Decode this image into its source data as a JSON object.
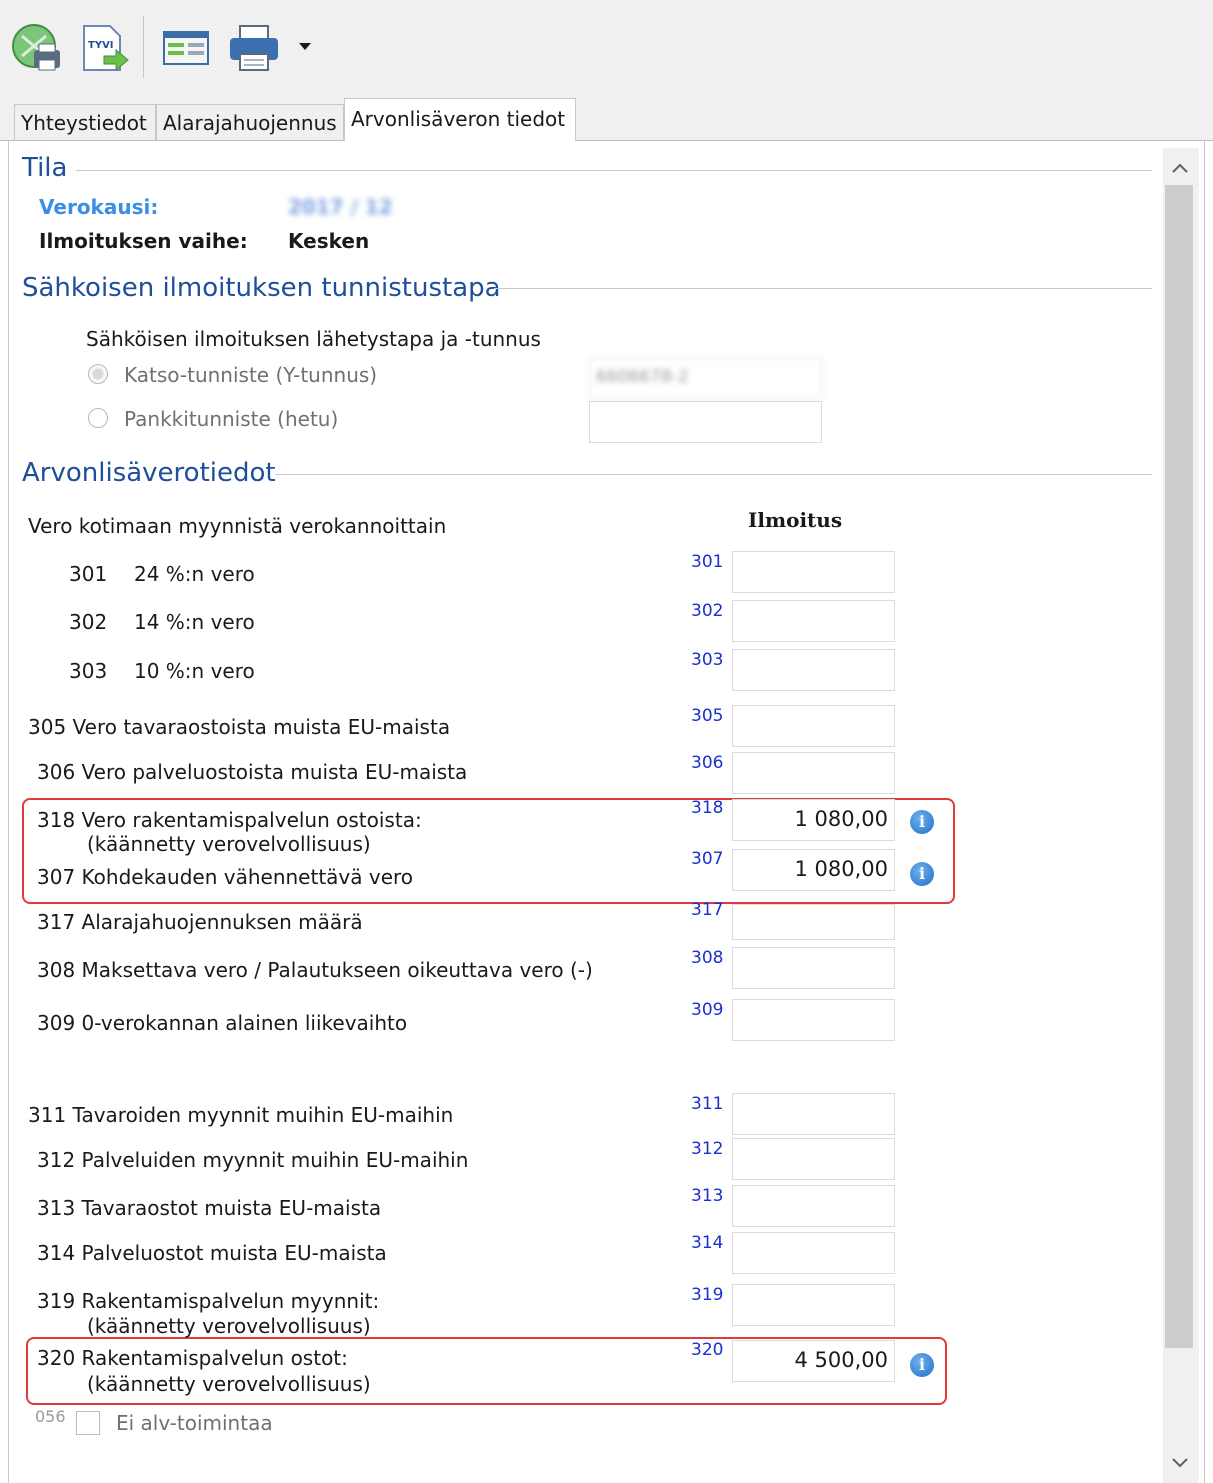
{
  "toolbar": {
    "buttons": [
      {
        "name": "send-print-icon"
      },
      {
        "name": "tyvi-send-icon",
        "label": "TYVI"
      },
      {
        "name": "form-view-icon"
      },
      {
        "name": "printer-icon"
      }
    ],
    "dropdown_icon": "chevron-down-icon"
  },
  "tabs": [
    {
      "label": "Yhteystiedot"
    },
    {
      "label": "Alarajahuojennus"
    },
    {
      "label": "Arvonlisäveron tiedot",
      "active": true
    }
  ],
  "tila": {
    "title": "Tila",
    "period_label": "Verokausi:",
    "period_value": "2017 / 12",
    "stage_label": "Ilmoituksen vaihe:",
    "stage_value": "Kesken"
  },
  "identification": {
    "title": "Sähkoisen ilmoituksen tunnistustapa",
    "subtitle": "Sähköisen ilmoituksen lähetystapa ja -tunnus",
    "option_katso": "Katso-tunniste (Y-tunnus)",
    "option_bank": "Pankkitunniste (hetu)",
    "katso_value": "6606678-2",
    "bank_value": ""
  },
  "vat": {
    "title": "Arvonlisäverotiedot",
    "column_header": "Ilmoitus",
    "domestic_header": "Vero kotimaan myynnistä verokannoittain",
    "rows": [
      {
        "num": "301",
        "label": "24 %:n vero",
        "code": "301",
        "value": ""
      },
      {
        "num": "302",
        "label": "14 %:n vero",
        "code": "302",
        "value": ""
      },
      {
        "num": "303",
        "label": "10 %:n vero",
        "code": "303",
        "value": ""
      },
      {
        "label": "305 Vero tavaraostoista muista EU-maista",
        "code": "305",
        "value": ""
      },
      {
        "label": "306 Vero palveluostoista muista EU-maista",
        "code": "306",
        "value": ""
      },
      {
        "label": "318 Vero rakentamispalvelun ostoista:",
        "sublabel": "(käännetty verovelvollisuus)",
        "code": "318",
        "value": "1 080,00"
      },
      {
        "label": "307 Kohdekauden vähennettävä vero",
        "code": "307",
        "value": "1 080,00"
      },
      {
        "label": "317 Alarajahuojennuksen määrä",
        "code": "317",
        "value": ""
      },
      {
        "label": "308 Maksettava vero / Palautukseen oikeuttava vero (-)",
        "code": "308",
        "value": ""
      },
      {
        "label": "309 0-verokannan alainen liikevaihto",
        "code": "309",
        "value": ""
      },
      {
        "label": "311 Tavaroiden myynnit muihin EU-maihin",
        "code": "311",
        "value": ""
      },
      {
        "label": "312 Palveluiden myynnit muihin EU-maihin",
        "code": "312",
        "value": ""
      },
      {
        "label": "313 Tavaraostot muista EU-maista",
        "code": "313",
        "value": ""
      },
      {
        "label": "314 Palveluostot muista EU-maista",
        "code": "314",
        "value": ""
      },
      {
        "label": "319 Rakentamispalvelun myynnit:",
        "sublabel": "(käännetty verovelvollisuus)",
        "code": "319",
        "value": ""
      },
      {
        "label": "320 Rakentamispalvelun ostot:",
        "sublabel": "(käännetty verovelvollisuus)",
        "code": "320",
        "value": "4 500,00"
      }
    ],
    "no_vat_code": "056",
    "no_vat_label": "Ei alv-toimintaa"
  },
  "colors": {
    "accent": "#1f4e9a",
    "code": "#1a30d0",
    "highlight": "#e03a3a",
    "info": "#1f6fc7"
  }
}
